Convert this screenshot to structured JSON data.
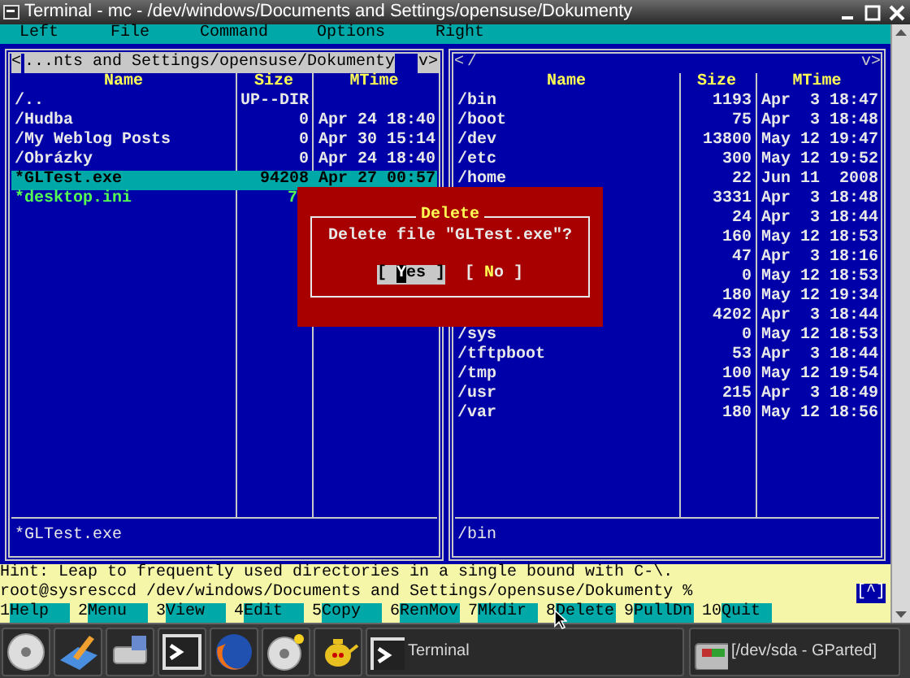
{
  "window": {
    "title": "Terminal - mc - /dev/windows/Documents and Settings/opensuse/Dokumenty"
  },
  "menu_bar": [
    "Left",
    "File",
    "Command",
    "Options",
    "Right"
  ],
  "panels": [
    {
      "active": true,
      "path_open": "<",
      "path": "...nts and Settings/opensuse/Dokumenty",
      "path_close": "v>",
      "columns": [
        "Name",
        "Size",
        "MTime"
      ],
      "rows": [
        {
          "name": "/..",
          "size": "UP--DIR",
          "kind": "dir",
          "selected": false
        },
        {
          "name": "/Hudba",
          "size": "0",
          "mtime": "Apr 24 18:40",
          "kind": "dir",
          "selected": false
        },
        {
          "name": "/My Weblog Posts",
          "size": "0",
          "mtime": "Apr 30 15:14",
          "kind": "dir",
          "selected": false
        },
        {
          "name": "/Obrázky",
          "size": "0",
          "mtime": "Apr 24 18:40",
          "kind": "dir",
          "selected": false
        },
        {
          "name": "*GLTest.exe",
          "size": "94208",
          "mtime": "Apr 27 00:57",
          "kind": "exec",
          "selected": true
        },
        {
          "name": "*desktop.ini",
          "size": "7",
          "kind": "exec",
          "selected": false,
          "covered": true
        }
      ],
      "mini_status": "*GLTest.exe"
    },
    {
      "active": false,
      "path_open": "<",
      "path": "/",
      "path_close": "v>",
      "columns": [
        "Name",
        "Size",
        "MTime"
      ],
      "rows": [
        {
          "name": "/bin",
          "size": "1193",
          "mtime": "Apr  3 18:47",
          "kind": "dir",
          "selected": false
        },
        {
          "name": "/boot",
          "size": "75",
          "mtime": "Apr  3 18:48",
          "kind": "dir",
          "selected": false
        },
        {
          "name": "/dev",
          "size": "13800",
          "mtime": "May 12 19:47",
          "kind": "dir",
          "selected": false
        },
        {
          "name": "/etc",
          "size": "300",
          "mtime": "May 12 19:52",
          "kind": "dir",
          "selected": false
        },
        {
          "name": "/home",
          "size": "22",
          "mtime": "Jun 11  2008",
          "kind": "dir",
          "selected": false
        },
        {
          "size": "3331",
          "mtime": "Apr  3 18:48",
          "kind": "dir",
          "selected": false
        },
        {
          "size": "24",
          "mtime": "Apr  3 18:44",
          "kind": "dir",
          "selected": false
        },
        {
          "size": "160",
          "mtime": "May 12 18:53",
          "kind": "dir",
          "selected": false
        },
        {
          "size": "47",
          "mtime": "Apr  3 18:16",
          "kind": "dir",
          "selected": false
        },
        {
          "size": "0",
          "mtime": "May 12 18:53",
          "kind": "dir",
          "selected": false
        },
        {
          "size": "180",
          "mtime": "May 12 19:34",
          "kind": "dir",
          "selected": false
        },
        {
          "size": "4202",
          "mtime": "Apr  3 18:44",
          "kind": "dir",
          "selected": false
        },
        {
          "name": "/sys",
          "size": "0",
          "mtime": "May 12 18:53",
          "kind": "dir",
          "selected": false
        },
        {
          "name": "/tftpboot",
          "size": "53",
          "mtime": "Apr  3 18:44",
          "kind": "dir",
          "selected": false
        },
        {
          "name": "/tmp",
          "size": "100",
          "mtime": "May 12 19:54",
          "kind": "dir",
          "selected": false
        },
        {
          "name": "/usr",
          "size": "215",
          "mtime": "Apr  3 18:49",
          "kind": "dir",
          "selected": false
        },
        {
          "name": "/var",
          "size": "180",
          "mtime": "May 12 18:56",
          "kind": "dir",
          "selected": false
        }
      ],
      "mini_status": "/bin"
    }
  ],
  "dialog": {
    "title": "Delete",
    "message": "Delete file \"GLTest.exe\"?",
    "buttons": [
      {
        "open": "[ ",
        "hotkey": "Y",
        "rest": "es",
        "close": " ]",
        "selected": true
      },
      {
        "open": "[ ",
        "hotkey": "N",
        "rest": "o",
        "close": " ]",
        "selected": false
      }
    ]
  },
  "hint": "Hint: Leap to frequently used directories in a single bound with C-\\.",
  "prompt": "root@sysresccd /dev/windows/Documents and Settings/opensuse/Dokumenty %",
  "prompt_button": "[^]",
  "function_keys": [
    {
      "num": "1",
      "label": "Help"
    },
    {
      "num": "2",
      "label": "Menu"
    },
    {
      "num": "3",
      "label": "View"
    },
    {
      "num": "4",
      "label": "Edit"
    },
    {
      "num": "5",
      "label": "Copy"
    },
    {
      "num": "6",
      "label": "RenMov"
    },
    {
      "num": "7",
      "label": "Mkdir"
    },
    {
      "num": "8",
      "label": "Delete"
    },
    {
      "num": "9",
      "label": "PullDn"
    },
    {
      "num": "10",
      "label": "Quit"
    }
  ],
  "taskbar": {
    "launchers": [
      {
        "kind": "disc"
      },
      {
        "kind": "pen"
      },
      {
        "kind": "drive"
      },
      {
        "kind": "terminal"
      },
      {
        "kind": "globe"
      },
      {
        "kind": "disc-star"
      },
      {
        "kind": "teapot"
      }
    ],
    "tasks": [
      {
        "kind": "terminal",
        "label": "Terminal"
      },
      {
        "kind": "gparted",
        "label": "[/dev/sda - GParted]"
      }
    ]
  }
}
